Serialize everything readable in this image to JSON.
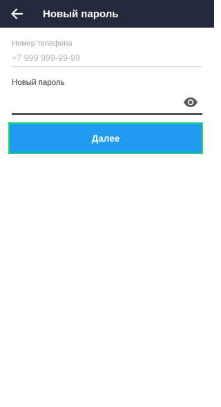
{
  "header": {
    "title": "Новый пароль",
    "back_icon": "arrow-left-icon",
    "background": "#232a3b"
  },
  "phone": {
    "label": "Номер телефона",
    "value": "+7 999 999-99-99"
  },
  "password": {
    "label": "Новый пароль",
    "value": "",
    "toggle_icon": "eye-icon"
  },
  "next_button": {
    "label": "Далее",
    "color": "#1f9bf0",
    "border_color": "#1fd96f"
  }
}
